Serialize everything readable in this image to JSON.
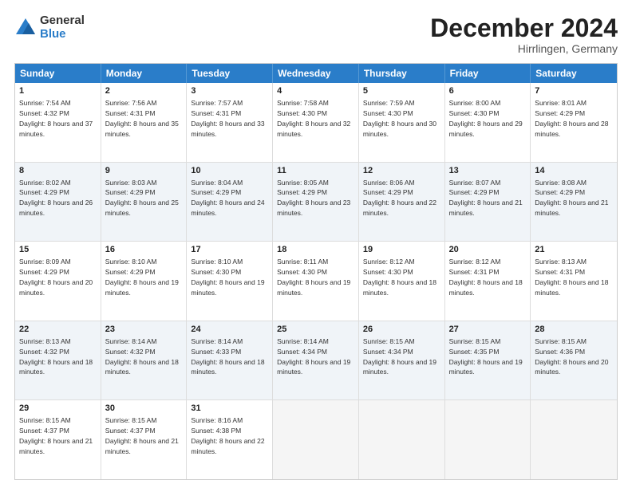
{
  "logo": {
    "general": "General",
    "blue": "Blue"
  },
  "header": {
    "month": "December 2024",
    "location": "Hirrlingen, Germany"
  },
  "days": [
    "Sunday",
    "Monday",
    "Tuesday",
    "Wednesday",
    "Thursday",
    "Friday",
    "Saturday"
  ],
  "weeks": [
    [
      {
        "day": "1",
        "sunrise": "7:54 AM",
        "sunset": "4:32 PM",
        "daylight": "8 hours and 37 minutes."
      },
      {
        "day": "2",
        "sunrise": "7:56 AM",
        "sunset": "4:31 PM",
        "daylight": "8 hours and 35 minutes."
      },
      {
        "day": "3",
        "sunrise": "7:57 AM",
        "sunset": "4:31 PM",
        "daylight": "8 hours and 33 minutes."
      },
      {
        "day": "4",
        "sunrise": "7:58 AM",
        "sunset": "4:30 PM",
        "daylight": "8 hours and 32 minutes."
      },
      {
        "day": "5",
        "sunrise": "7:59 AM",
        "sunset": "4:30 PM",
        "daylight": "8 hours and 30 minutes."
      },
      {
        "day": "6",
        "sunrise": "8:00 AM",
        "sunset": "4:30 PM",
        "daylight": "8 hours and 29 minutes."
      },
      {
        "day": "7",
        "sunrise": "8:01 AM",
        "sunset": "4:29 PM",
        "daylight": "8 hours and 28 minutes."
      }
    ],
    [
      {
        "day": "8",
        "sunrise": "8:02 AM",
        "sunset": "4:29 PM",
        "daylight": "8 hours and 26 minutes."
      },
      {
        "day": "9",
        "sunrise": "8:03 AM",
        "sunset": "4:29 PM",
        "daylight": "8 hours and 25 minutes."
      },
      {
        "day": "10",
        "sunrise": "8:04 AM",
        "sunset": "4:29 PM",
        "daylight": "8 hours and 24 minutes."
      },
      {
        "day": "11",
        "sunrise": "8:05 AM",
        "sunset": "4:29 PM",
        "daylight": "8 hours and 23 minutes."
      },
      {
        "day": "12",
        "sunrise": "8:06 AM",
        "sunset": "4:29 PM",
        "daylight": "8 hours and 22 minutes."
      },
      {
        "day": "13",
        "sunrise": "8:07 AM",
        "sunset": "4:29 PM",
        "daylight": "8 hours and 21 minutes."
      },
      {
        "day": "14",
        "sunrise": "8:08 AM",
        "sunset": "4:29 PM",
        "daylight": "8 hours and 21 minutes."
      }
    ],
    [
      {
        "day": "15",
        "sunrise": "8:09 AM",
        "sunset": "4:29 PM",
        "daylight": "8 hours and 20 minutes."
      },
      {
        "day": "16",
        "sunrise": "8:10 AM",
        "sunset": "4:29 PM",
        "daylight": "8 hours and 19 minutes."
      },
      {
        "day": "17",
        "sunrise": "8:10 AM",
        "sunset": "4:30 PM",
        "daylight": "8 hours and 19 minutes."
      },
      {
        "day": "18",
        "sunrise": "8:11 AM",
        "sunset": "4:30 PM",
        "daylight": "8 hours and 19 minutes."
      },
      {
        "day": "19",
        "sunrise": "8:12 AM",
        "sunset": "4:30 PM",
        "daylight": "8 hours and 18 minutes."
      },
      {
        "day": "20",
        "sunrise": "8:12 AM",
        "sunset": "4:31 PM",
        "daylight": "8 hours and 18 minutes."
      },
      {
        "day": "21",
        "sunrise": "8:13 AM",
        "sunset": "4:31 PM",
        "daylight": "8 hours and 18 minutes."
      }
    ],
    [
      {
        "day": "22",
        "sunrise": "8:13 AM",
        "sunset": "4:32 PM",
        "daylight": "8 hours and 18 minutes."
      },
      {
        "day": "23",
        "sunrise": "8:14 AM",
        "sunset": "4:32 PM",
        "daylight": "8 hours and 18 minutes."
      },
      {
        "day": "24",
        "sunrise": "8:14 AM",
        "sunset": "4:33 PM",
        "daylight": "8 hours and 18 minutes."
      },
      {
        "day": "25",
        "sunrise": "8:14 AM",
        "sunset": "4:34 PM",
        "daylight": "8 hours and 19 minutes."
      },
      {
        "day": "26",
        "sunrise": "8:15 AM",
        "sunset": "4:34 PM",
        "daylight": "8 hours and 19 minutes."
      },
      {
        "day": "27",
        "sunrise": "8:15 AM",
        "sunset": "4:35 PM",
        "daylight": "8 hours and 19 minutes."
      },
      {
        "day": "28",
        "sunrise": "8:15 AM",
        "sunset": "4:36 PM",
        "daylight": "8 hours and 20 minutes."
      }
    ],
    [
      {
        "day": "29",
        "sunrise": "8:15 AM",
        "sunset": "4:37 PM",
        "daylight": "8 hours and 21 minutes."
      },
      {
        "day": "30",
        "sunrise": "8:15 AM",
        "sunset": "4:37 PM",
        "daylight": "8 hours and 21 minutes."
      },
      {
        "day": "31",
        "sunrise": "8:16 AM",
        "sunset": "4:38 PM",
        "daylight": "8 hours and 22 minutes."
      },
      null,
      null,
      null,
      null
    ]
  ]
}
